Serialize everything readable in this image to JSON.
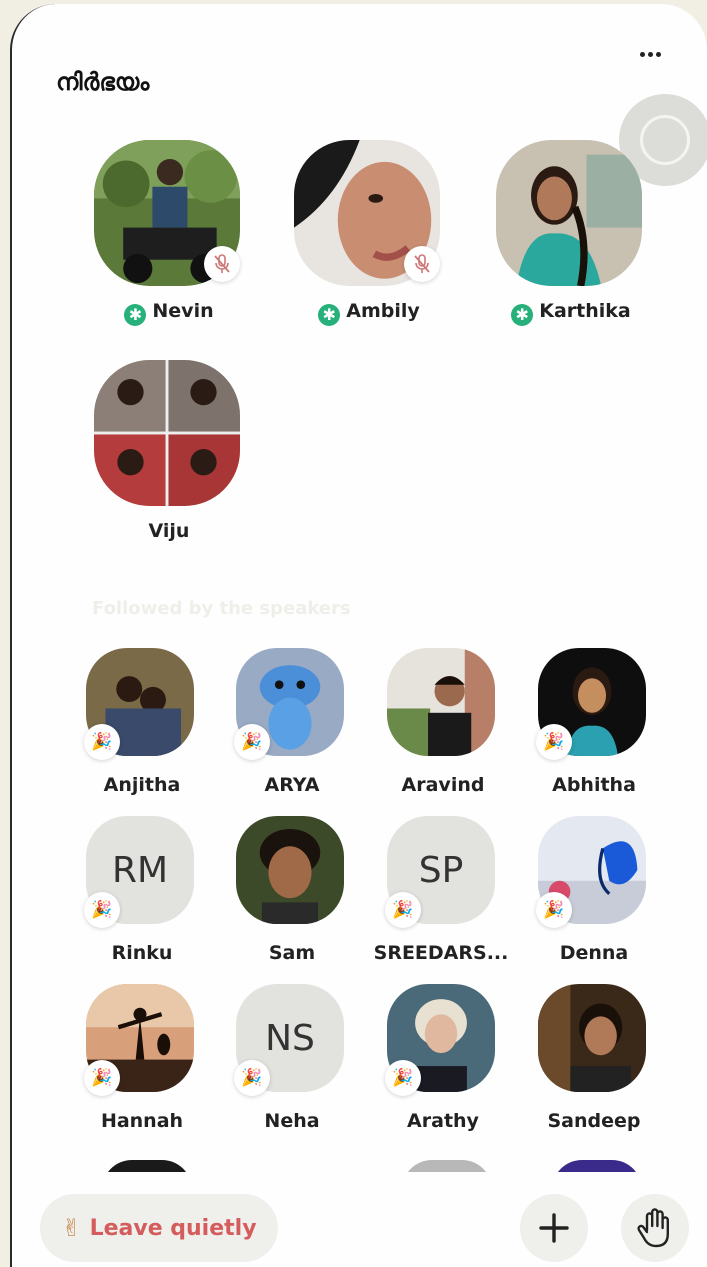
{
  "room": {
    "title": "നിർഭയം"
  },
  "speakers": [
    {
      "name": "Nevin",
      "moderator": true,
      "muted": true
    },
    {
      "name": "Ambily",
      "moderator": true,
      "muted": true
    },
    {
      "name": "Karthika",
      "moderator": true,
      "muted": false
    },
    {
      "name": "Viju",
      "moderator": false,
      "muted": false
    }
  ],
  "section": {
    "followed_label": "Followed by the speakers"
  },
  "listeners": [
    {
      "name": "Anjitha",
      "initials": ""
    },
    {
      "name": "ARYA",
      "initials": ""
    },
    {
      "name": "Aravind",
      "initials": ""
    },
    {
      "name": "Abhitha",
      "initials": ""
    },
    {
      "name": "Rinku",
      "initials": "RM"
    },
    {
      "name": "Sam",
      "initials": ""
    },
    {
      "name": "SREEDARS...",
      "initials": "SP"
    },
    {
      "name": "Denna",
      "initials": ""
    },
    {
      "name": "Hannah",
      "initials": ""
    },
    {
      "name": "Neha",
      "initials": "NS"
    },
    {
      "name": "Arathy",
      "initials": ""
    },
    {
      "name": "Sandeep",
      "initials": ""
    }
  ],
  "controls": {
    "leave_label": "Leave quietly",
    "leave_icon": "✌",
    "add_icon": "plus-icon",
    "raise_hand_icon": "hand-icon",
    "more_icon": "more-dots-icon"
  },
  "icons": {
    "mod_glyph": "✱",
    "new_badge": "🎉"
  },
  "colors": {
    "moderator": "#27b07a",
    "leave_text": "#d45c5c",
    "background": "#fefefe"
  }
}
